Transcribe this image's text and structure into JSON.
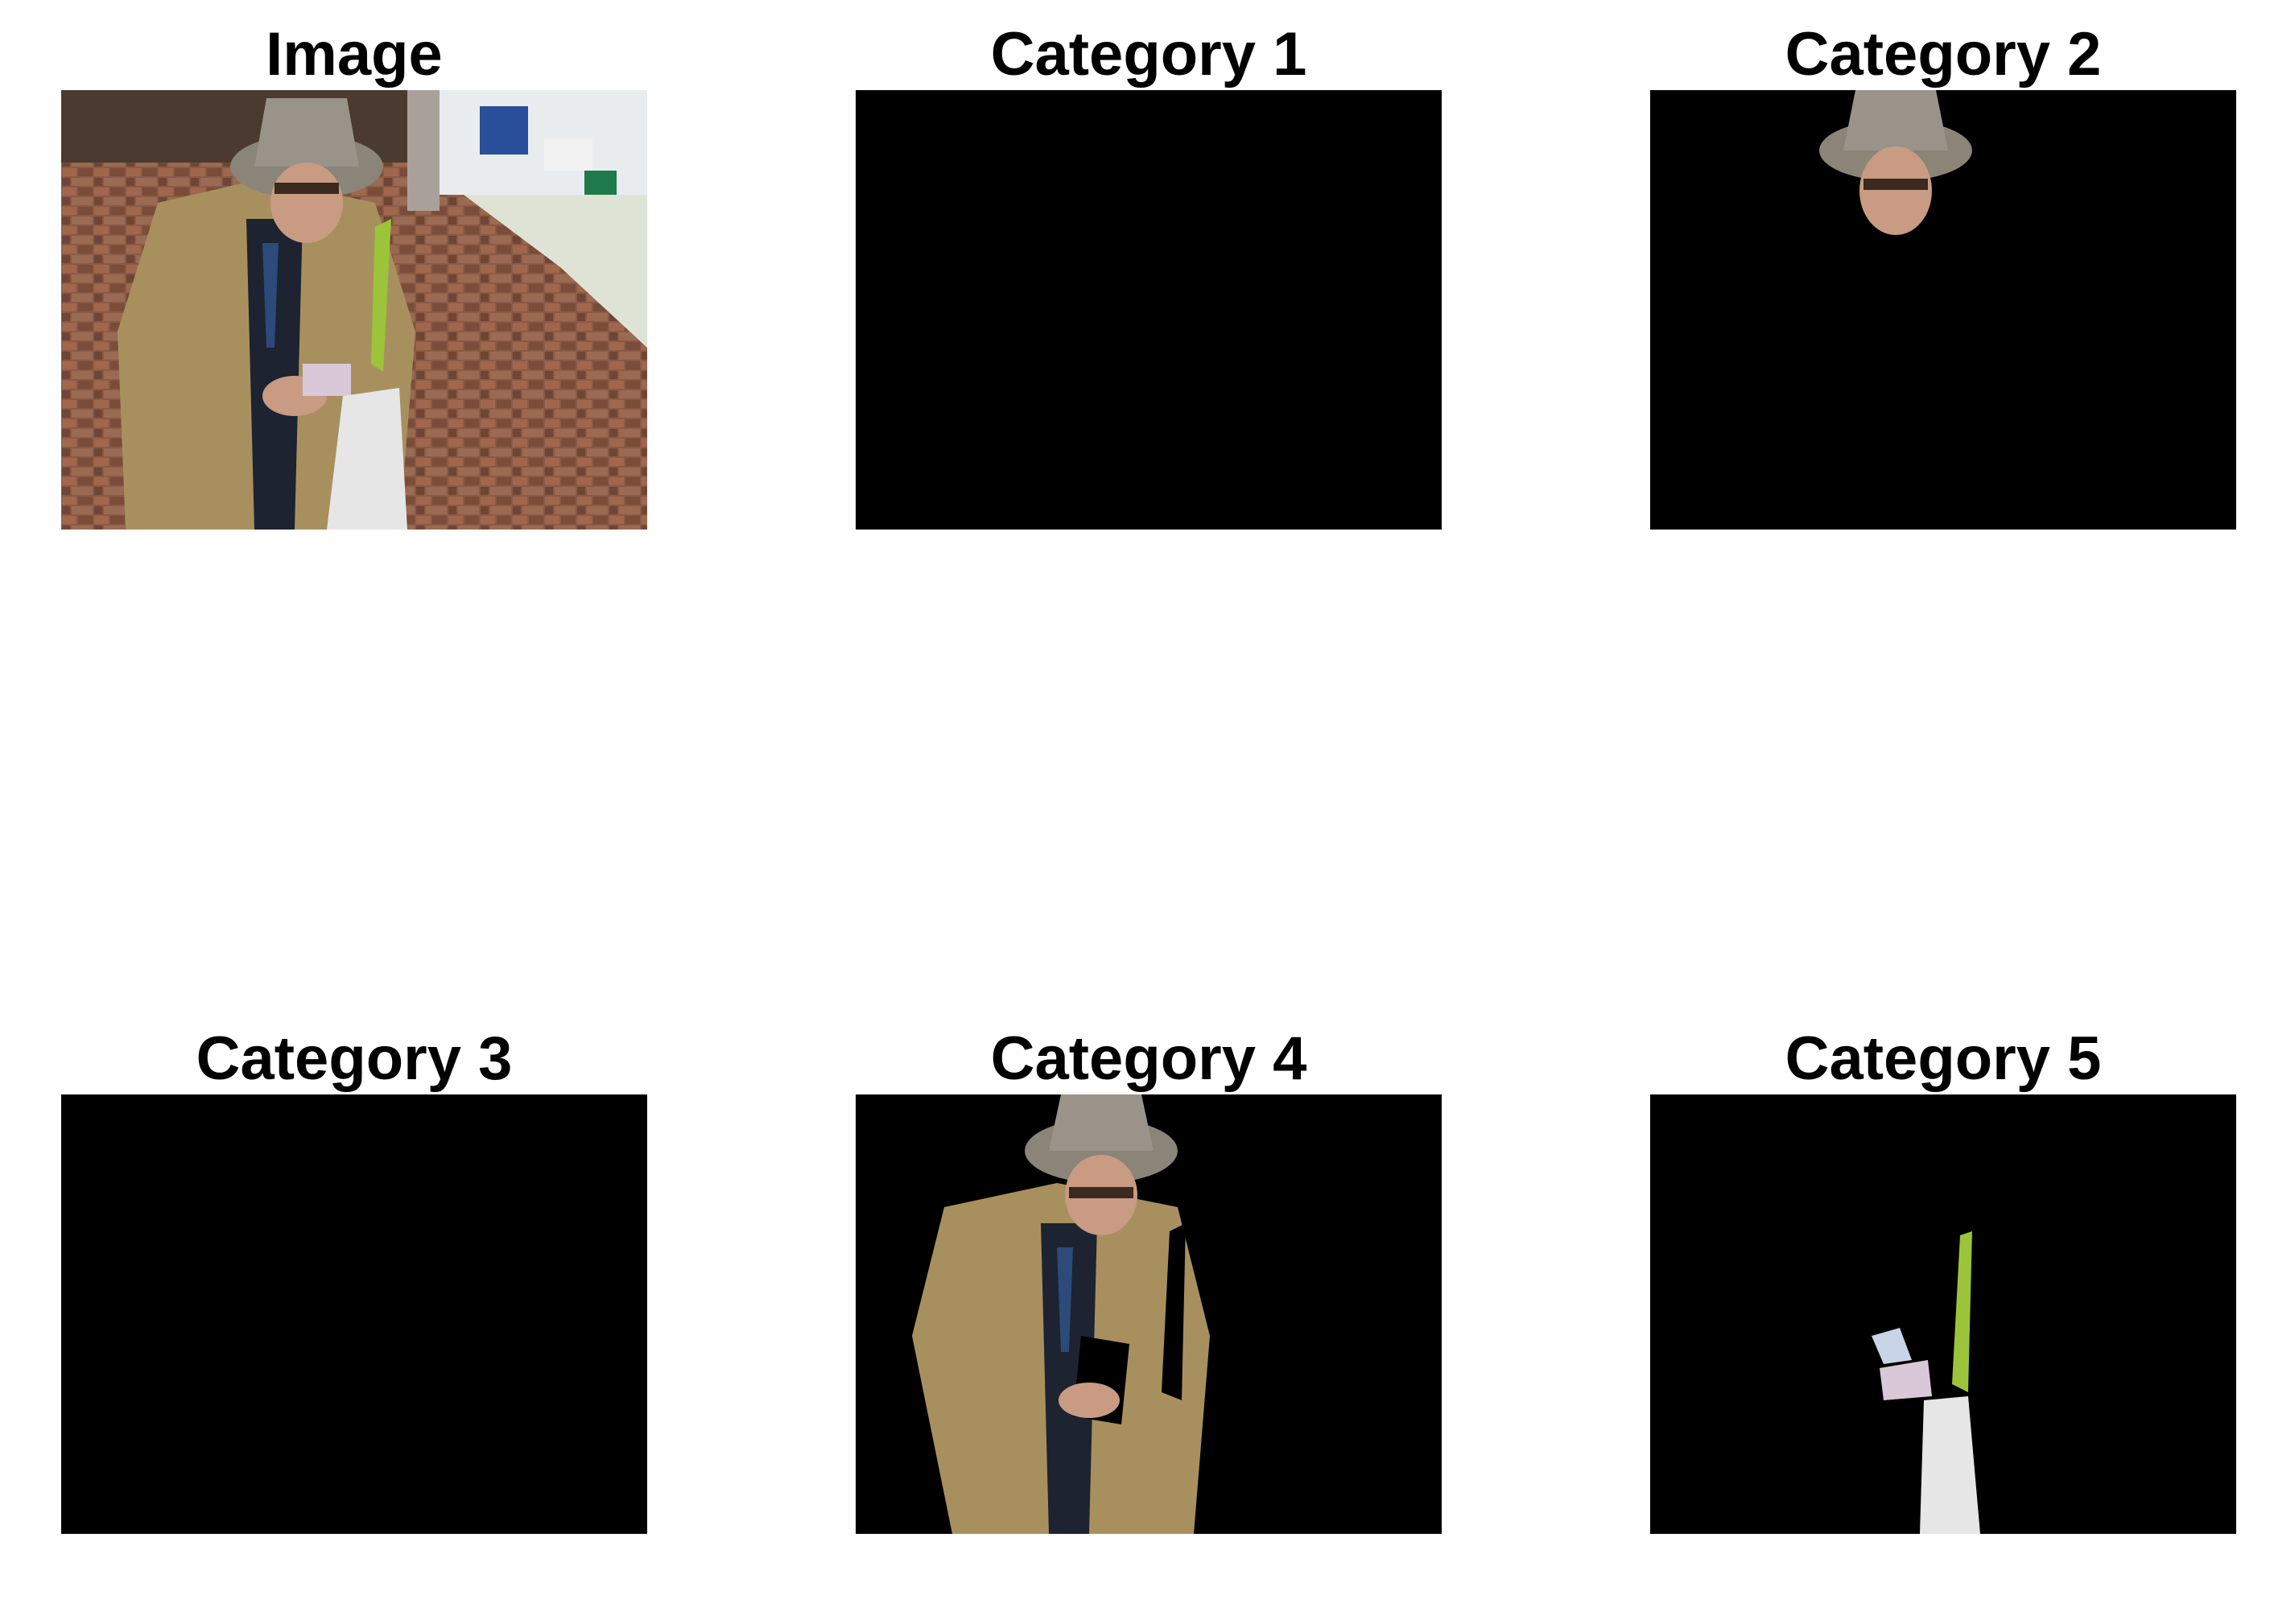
{
  "panels": [
    {
      "title": "Image"
    },
    {
      "title": "Category 1"
    },
    {
      "title": "Category 2"
    },
    {
      "title": "Category 3"
    },
    {
      "title": "Category 4"
    },
    {
      "title": "Category 5"
    }
  ],
  "colors": {
    "mask_background": "#000000",
    "coat": "#a8905e",
    "hat": "#8b8478",
    "floor": "#8a5a45",
    "bag": "#e6e6e6",
    "green_item": "#9cc43a"
  }
}
